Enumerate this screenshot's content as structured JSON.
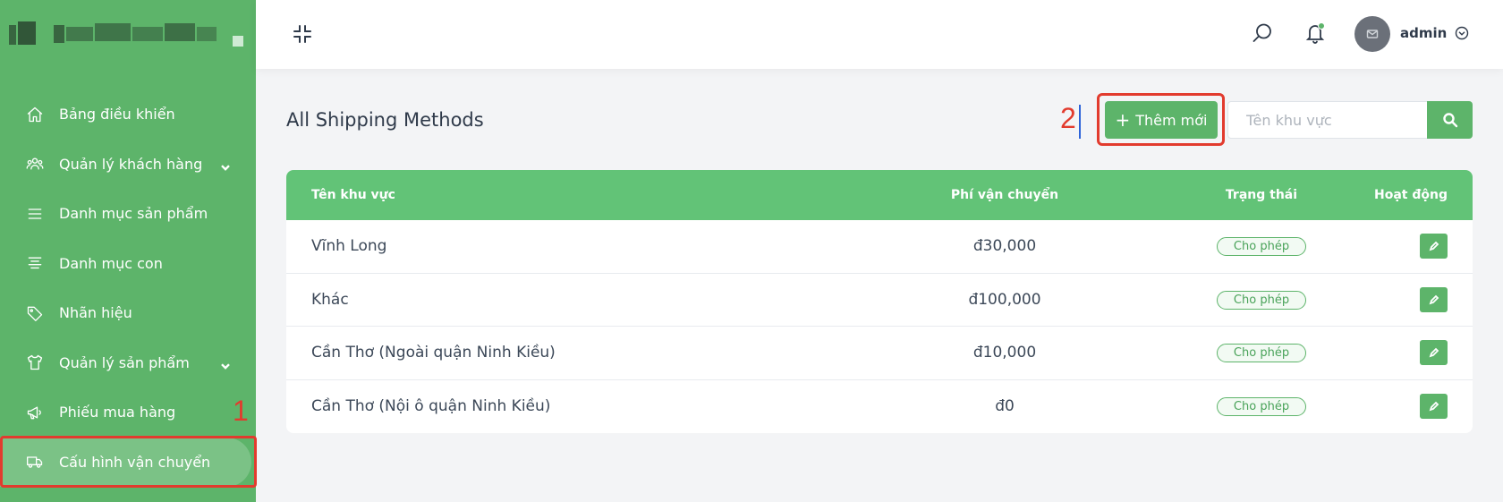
{
  "sidebar": {
    "items": [
      {
        "label": "Bảng điều khiển",
        "icon": "home-icon",
        "has_submenu": false
      },
      {
        "label": "Quản lý khách hàng",
        "icon": "users-icon",
        "has_submenu": true
      },
      {
        "label": "Danh mục sản phẩm",
        "icon": "menu-icon",
        "has_submenu": false
      },
      {
        "label": "Danh mục con",
        "icon": "align-center-icon",
        "has_submenu": false
      },
      {
        "label": "Nhãn hiệu",
        "icon": "tag-icon",
        "has_submenu": false
      },
      {
        "label": "Quản lý sản phẩm",
        "icon": "shirt-icon",
        "has_submenu": true
      },
      {
        "label": "Phiếu mua hàng",
        "icon": "megaphone-icon",
        "has_submenu": false
      },
      {
        "label": "Cấu hình vận chuyển",
        "icon": "truck-icon",
        "has_submenu": false,
        "active": true
      }
    ]
  },
  "annotations": {
    "one": "1",
    "two": "2",
    "color": "#e23b2e"
  },
  "topbar": {
    "username": "admin"
  },
  "main": {
    "title": "All Shipping Methods",
    "add_button_label": "Thêm mới",
    "search_placeholder": "Tên khu vực"
  },
  "table": {
    "headers": {
      "name": "Tên khu vực",
      "fee": "Phí vận chuyển",
      "status": "Trạng thái",
      "action": "Hoạt động"
    },
    "rows": [
      {
        "name": "Vĩnh Long",
        "fee": "đ30,000",
        "status": "Cho phép"
      },
      {
        "name": "Khác",
        "fee": "đ100,000",
        "status": "Cho phép"
      },
      {
        "name": "Cần Thơ (Ngoài quận Ninh Kiều)",
        "fee": "đ10,000",
        "status": "Cho phép"
      },
      {
        "name": "Cần Thơ (Nội ô quận Ninh Kiều)",
        "fee": "đ0",
        "status": "Cho phép"
      }
    ]
  },
  "colors": {
    "brand": "#5db46a",
    "table_header": "#62c377",
    "active_item": "#7bc286"
  }
}
